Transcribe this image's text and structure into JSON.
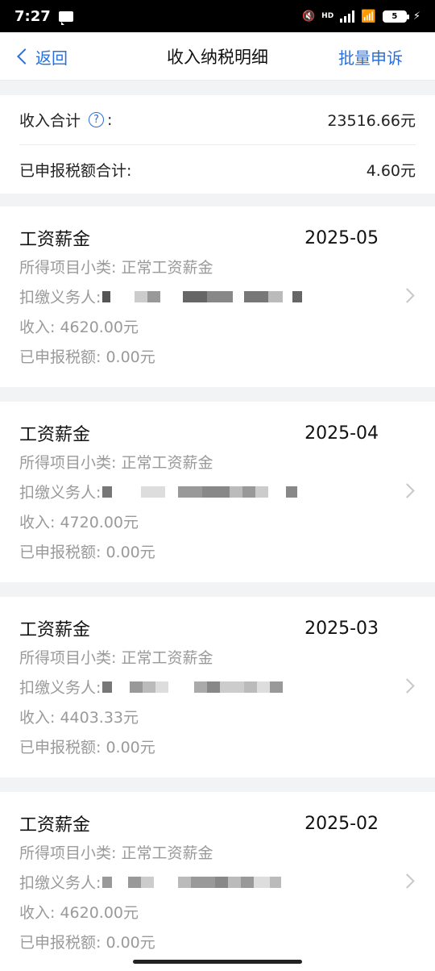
{
  "status_bar": {
    "time": "7:27",
    "battery": "5",
    "hd": "HD"
  },
  "nav": {
    "back_label": "返回",
    "title": "收入纳税明细",
    "action_label": "批量申诉"
  },
  "summary": {
    "income_label": "收入合计",
    "income_help": "?",
    "income_colon": ":",
    "income_value": "23516.66元",
    "tax_label": "已申报税额合计:",
    "tax_value": "4.60元"
  },
  "records": [
    {
      "type": "工资薪金",
      "period": "2025-05",
      "subcategory": "所得项目小类:  正常工资薪金",
      "withholder_label": "扣缴义务人:",
      "income": "收入:  4620.00元",
      "tax": "已申报税额:  0.00元"
    },
    {
      "type": "工资薪金",
      "period": "2025-04",
      "subcategory": "所得项目小类:  正常工资薪金",
      "withholder_label": "扣缴义务人:",
      "income": "收入:  4720.00元",
      "tax": "已申报税额:  0.00元"
    },
    {
      "type": "工资薪金",
      "period": "2025-03",
      "subcategory": "所得项目小类:  正常工资薪金",
      "withholder_label": "扣缴义务人:",
      "income": "收入:  4403.33元",
      "tax": "已申报税额:  0.00元"
    },
    {
      "type": "工资薪金",
      "period": "2025-02",
      "subcategory": "所得项目小类:  正常工资薪金",
      "withholder_label": "扣缴义务人:",
      "income": "收入:  4620.00元",
      "tax": "已申报税额:  0.00元"
    }
  ],
  "colors": {
    "accent": "#2a6fdb",
    "muted_text": "#9a9a9a",
    "background": "#f2f3f5"
  }
}
